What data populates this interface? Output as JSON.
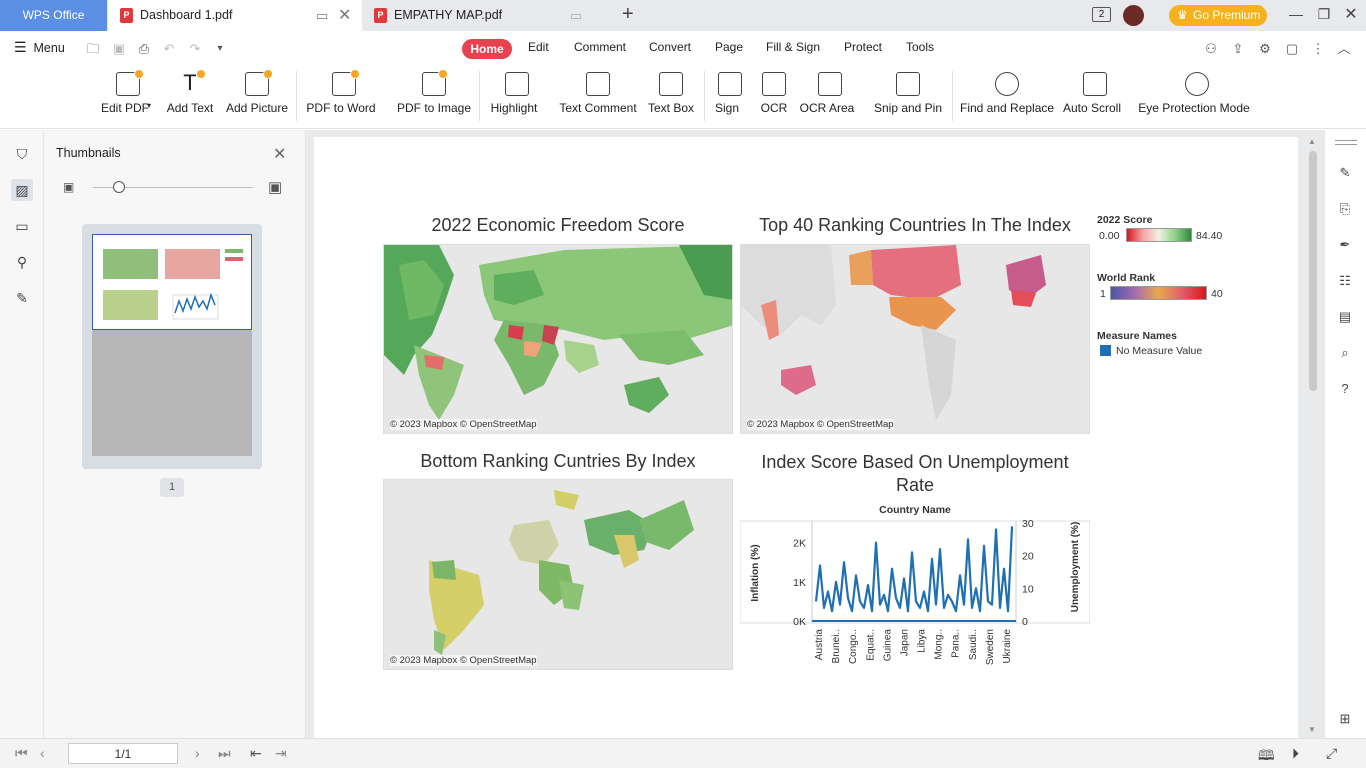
{
  "titlebar": {
    "app_name": "WPS Office",
    "tabs": [
      {
        "label": "Dashboard 1.pdf",
        "active": true
      },
      {
        "label": "EMPATHY MAP.pdf",
        "active": false
      }
    ],
    "account_count": "2",
    "premium_label": "Go Premium"
  },
  "menu": {
    "menu_label": "Menu",
    "tabs": [
      "Home",
      "Edit",
      "Comment",
      "Convert",
      "Page",
      "Fill & Sign",
      "Protect",
      "Tools"
    ],
    "active_tab": "Home"
  },
  "ribbon": {
    "items": [
      {
        "label": "Edit PDF",
        "dropdown": true,
        "premium": true
      },
      {
        "label": "Add Text",
        "premium": true
      },
      {
        "label": "Add Picture",
        "premium": true
      },
      {
        "label": "PDF to Word",
        "dropdown": true,
        "premium": true
      },
      {
        "label": "PDF to Image",
        "premium": true
      },
      {
        "label": "Highlight",
        "dropdown": true
      },
      {
        "label": "Text Comment"
      },
      {
        "label": "Text Box"
      },
      {
        "label": "Sign",
        "dropdown": true
      },
      {
        "label": "OCR"
      },
      {
        "label": "OCR Area",
        "dropdown": true
      },
      {
        "label": "Snip and Pin"
      },
      {
        "label": "Find and Replace"
      },
      {
        "label": "Auto Scroll",
        "dropdown": true
      },
      {
        "label": "Eye Protection Mode",
        "dropdown": true
      }
    ]
  },
  "thumbnails": {
    "title": "Thumbnails",
    "page_badge": "1"
  },
  "dashboard": {
    "map1_title": "2022 Economic Freedom Score",
    "map2_title": "Top 40 Ranking Countries In The Index",
    "map3_title": "Bottom Ranking Cuntries By Index",
    "chart_title": "Index Score Based On Unemployment Rate",
    "map_credit": "© 2023 Mapbox © OpenStreetMap",
    "legend": {
      "score_title": "2022 Score",
      "score_min": "0.00",
      "score_max": "84.40",
      "rank_title": "World Rank",
      "rank_min": "1",
      "rank_max": "40",
      "measure_title": "Measure Names",
      "measure_item": "No Measure Value",
      "measure_color": "#1f6fb2"
    }
  },
  "chart_data": {
    "type": "line",
    "title": "Index Score Based On Unemployment Rate",
    "subtitle": "Country Name",
    "xlabel": "",
    "ylabel": "Inflation (%)",
    "y2label": "Unemployment (%)",
    "y_ticks": [
      "0K",
      "1K",
      "2K"
    ],
    "y2_ticks": [
      "0",
      "10",
      "20",
      "30"
    ],
    "ylim": [
      0,
      2500
    ],
    "y2lim": [
      0,
      30
    ],
    "categories": [
      "Austria",
      "Brunei..",
      "Congo..",
      "Equat..",
      "Guinea",
      "Japan",
      "Libya",
      "Mong..",
      "Pana..",
      "Saudi..",
      "Sweden",
      "Ukraine"
    ],
    "series": [
      {
        "color": "#1f6fb2",
        "values": [
          6,
          17,
          4,
          9,
          3,
          12,
          5,
          18,
          7,
          3,
          14,
          6,
          4,
          11,
          3,
          24,
          5,
          8,
          3,
          16,
          7,
          4,
          13,
          3,
          21,
          6,
          4,
          9,
          3,
          19,
          5,
          22,
          4,
          8,
          6,
          3,
          14,
          5,
          25,
          4,
          10,
          3,
          23,
          6,
          5,
          28,
          4,
          16,
          3,
          29
        ]
      }
    ]
  }
}
